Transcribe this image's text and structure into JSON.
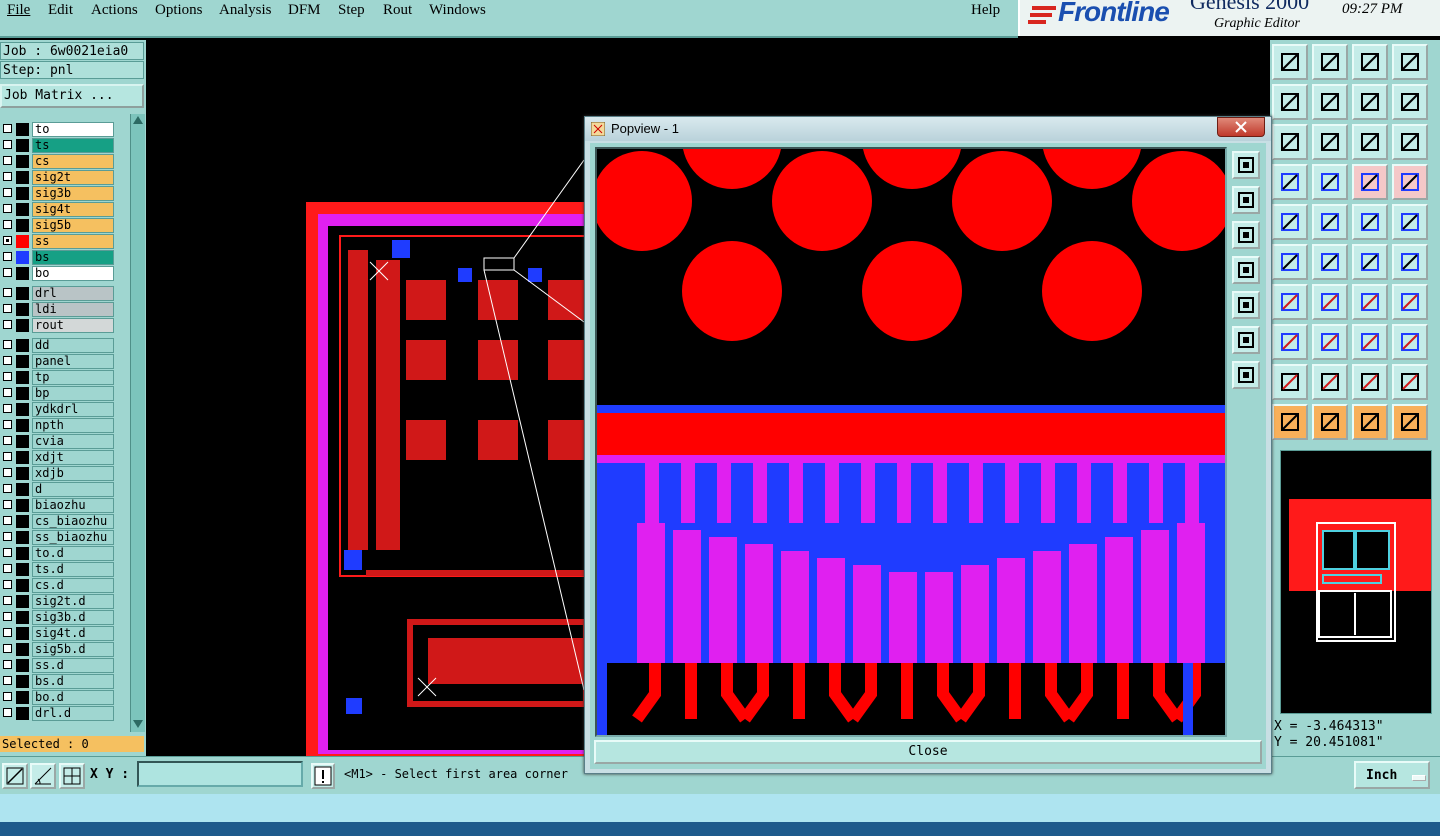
{
  "menu": [
    "File",
    "Edit",
    "Actions",
    "Options",
    "Analysis",
    "DFM",
    "Step",
    "Rout",
    "Windows"
  ],
  "help": "Help",
  "logo": {
    "brand": "Frontline",
    "product": "Genesis 2000",
    "subtitle": "Graphic Editor",
    "clock": "09:27 PM"
  },
  "job": {
    "job_line": "Job : 6w0021eia0",
    "step_line": "Step: pnl",
    "matrix_button": "Job Matrix ..."
  },
  "layers": [
    {
      "name": "to",
      "bg": "#ffffff",
      "sw": "#000000"
    },
    {
      "name": "ts",
      "bg": "#16a085",
      "sw": "#000000"
    },
    {
      "name": "cs",
      "bg": "#f5c060",
      "sw": "#000000"
    },
    {
      "name": "sig2t",
      "bg": "#f5c060",
      "sw": "#000000"
    },
    {
      "name": "sig3b",
      "bg": "#f5c060",
      "sw": "#000000"
    },
    {
      "name": "sig4t",
      "bg": "#f5c060",
      "sw": "#000000"
    },
    {
      "name": "sig5b",
      "bg": "#f5c060",
      "sw": "#000000"
    },
    {
      "name": "ss",
      "bg": "#f5c060",
      "sw": "#ff0000",
      "on": true
    },
    {
      "name": "bs",
      "bg": "#16a085",
      "sw": "#1f3cff"
    },
    {
      "name": "bo",
      "bg": "#ffffff",
      "sw": "#000000"
    },
    {
      "name": "drl",
      "bg": "#b9c4c6",
      "sw": "#000000"
    },
    {
      "name": "ldi",
      "bg": "#b9c4c6",
      "sw": "#000000"
    },
    {
      "name": "rout",
      "bg": "#d3d8d8",
      "sw": "#000000"
    },
    {
      "name": "dd",
      "bg": "#9fd6d0",
      "sw": "#000000"
    },
    {
      "name": "panel",
      "bg": "#9fd6d0",
      "sw": "#000000"
    },
    {
      "name": "tp",
      "bg": "#9fd6d0",
      "sw": "#000000"
    },
    {
      "name": "bp",
      "bg": "#9fd6d0",
      "sw": "#000000"
    },
    {
      "name": "ydkdrl",
      "bg": "#9fd6d0",
      "sw": "#000000"
    },
    {
      "name": "npth",
      "bg": "#9fd6d0",
      "sw": "#000000"
    },
    {
      "name": "cvia",
      "bg": "#9fd6d0",
      "sw": "#000000"
    },
    {
      "name": "xdjt",
      "bg": "#9fd6d0",
      "sw": "#000000"
    },
    {
      "name": "xdjb",
      "bg": "#9fd6d0",
      "sw": "#000000"
    },
    {
      "name": "d",
      "bg": "#9fd6d0",
      "sw": "#000000"
    },
    {
      "name": "biaozhu",
      "bg": "#9fd6d0",
      "sw": "#000000"
    },
    {
      "name": "cs_biaozhu",
      "bg": "#9fd6d0",
      "sw": "#000000"
    },
    {
      "name": "ss_biaozhu",
      "bg": "#9fd6d0",
      "sw": "#000000"
    },
    {
      "name": "to.d",
      "bg": "#9fd6d0",
      "sw": "#000000"
    },
    {
      "name": "ts.d",
      "bg": "#9fd6d0",
      "sw": "#000000"
    },
    {
      "name": "cs.d",
      "bg": "#9fd6d0",
      "sw": "#000000"
    },
    {
      "name": "sig2t.d",
      "bg": "#9fd6d0",
      "sw": "#000000"
    },
    {
      "name": "sig3b.d",
      "bg": "#9fd6d0",
      "sw": "#000000"
    },
    {
      "name": "sig4t.d",
      "bg": "#9fd6d0",
      "sw": "#000000"
    },
    {
      "name": "sig5b.d",
      "bg": "#9fd6d0",
      "sw": "#000000"
    },
    {
      "name": "ss.d",
      "bg": "#9fd6d0",
      "sw": "#000000"
    },
    {
      "name": "bs.d",
      "bg": "#9fd6d0",
      "sw": "#000000"
    },
    {
      "name": "bo.d",
      "bg": "#9fd6d0",
      "sw": "#000000"
    },
    {
      "name": "drl.d",
      "bg": "#9fd6d0",
      "sw": "#000000"
    }
  ],
  "selected_text": "Selected : 0",
  "popview": {
    "title": "Popview - 1",
    "close_label": "Close"
  },
  "coords": {
    "x": "X = -3.464313\"",
    "y": "Y = 20.451081\""
  },
  "status": {
    "xy_label": "X Y :",
    "xy_value": "",
    "message": "<M1> - Select first area corner",
    "units": "Inch"
  },
  "colors": {
    "panel": "#9fd6d0",
    "copper": "#ff0000",
    "mask": "#e020f0",
    "blue": "#1f3cff"
  }
}
